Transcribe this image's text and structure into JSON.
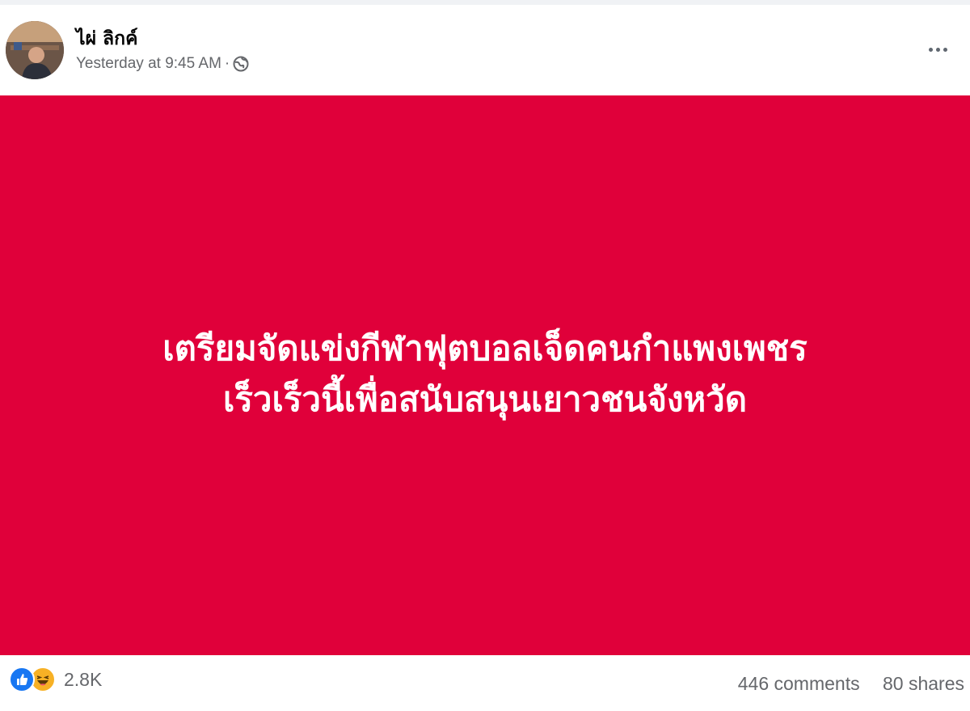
{
  "post": {
    "author": "ไผ่ ลิกค์",
    "timestamp": "Yesterday at 9:45 AM",
    "separator": "·",
    "privacy_icon": "globe-icon",
    "more_icon": "more-horizontal-icon",
    "banner": {
      "background_color": "#e0003a",
      "line1": "เตรียมจัดแข่งกีฬาฟุตบอลเจ็ดคนกำแพงเพชร",
      "line2": "เร็วเร็วนี้เพื่อสนับสนุนเยาวชนจังหวัด"
    },
    "reactions": {
      "icons": [
        "like-icon",
        "haha-icon"
      ],
      "count": "2.8K"
    },
    "comments": "446 comments",
    "shares": "80 shares"
  }
}
